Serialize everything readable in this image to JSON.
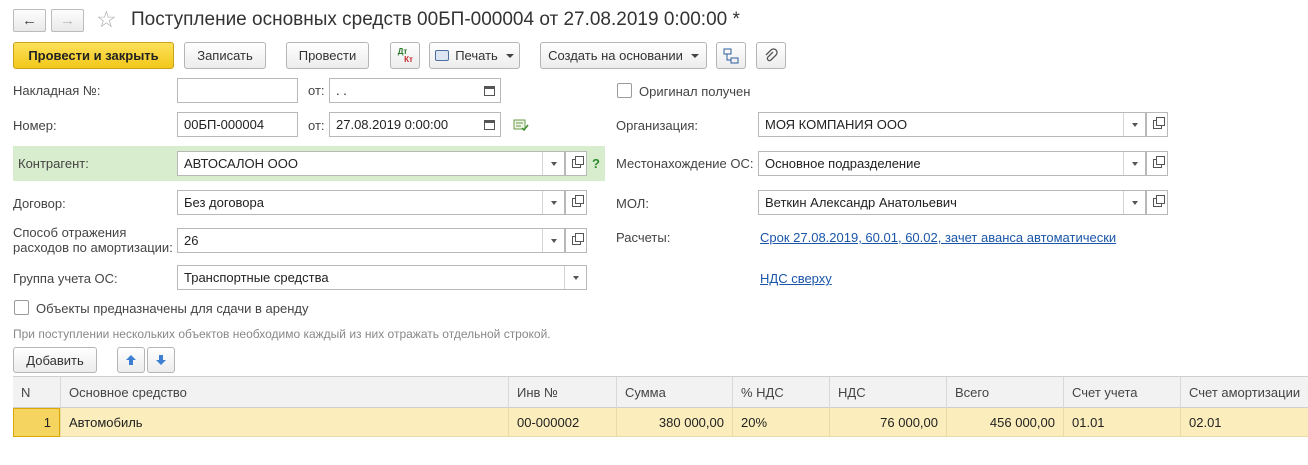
{
  "title": "Поступление основных средств 00БП-000004 от 27.08.2019 0:00:00 *",
  "toolbar": {
    "post_close": "Провести и закрыть",
    "save": "Записать",
    "post": "Провести",
    "dtkt_top": "Дт",
    "dtkt_bottom": "Кт",
    "print": "Печать",
    "create_based": "Создать на основании"
  },
  "form": {
    "invoice_label": "Накладная №:",
    "invoice_value": "",
    "invoice_from_label": "от:",
    "invoice_date": " .  .",
    "number_label": "Номер:",
    "number_value": "00БП-000004",
    "number_from_label": "от:",
    "number_date": "27.08.2019  0:00:00",
    "counterparty_label": "Контрагент:",
    "counterparty_value": "АВТОСАЛОН ООО",
    "help_mark": "?",
    "contract_label": "Договор:",
    "contract_value": "Без договора",
    "amort_label_1": "Способ отражения",
    "amort_label_2": "расходов по амортизации:",
    "amort_value": "26",
    "group_label": "Группа учета ОС:",
    "group_value": "Транспортные средства",
    "rent_checkbox_label": "Объекты предназначены для сдачи в аренду",
    "hint": "При поступлении нескольких объектов необходимо каждый из них отражать отдельной строкой.",
    "original_label": "Оригинал получен",
    "org_label": "Организация:",
    "org_value": "МОЯ КОМПАНИЯ ООО",
    "location_label": "Местонахождение ОС:",
    "location_value": "Основное подразделение",
    "mol_label": "МОЛ:",
    "mol_value": "Веткин Александр Анатольевич",
    "settlements_label": "Расчеты:",
    "settlements_link": "Срок 27.08.2019, 60.01, 60.02, зачет аванса автоматически",
    "vat_link": "НДС сверху"
  },
  "table_toolbar": {
    "add": "Добавить"
  },
  "table": {
    "headers": [
      "N",
      "Основное средство",
      "Инв №",
      "Сумма",
      "% НДС",
      "НДС",
      "Всего",
      "Счет учета",
      "Счет амортизации"
    ],
    "rows": [
      [
        "1",
        "Автомобиль",
        "00-000002",
        "380 000,00",
        "20%",
        "76 000,00",
        "456 000,00",
        "01.01",
        "02.01"
      ]
    ]
  }
}
